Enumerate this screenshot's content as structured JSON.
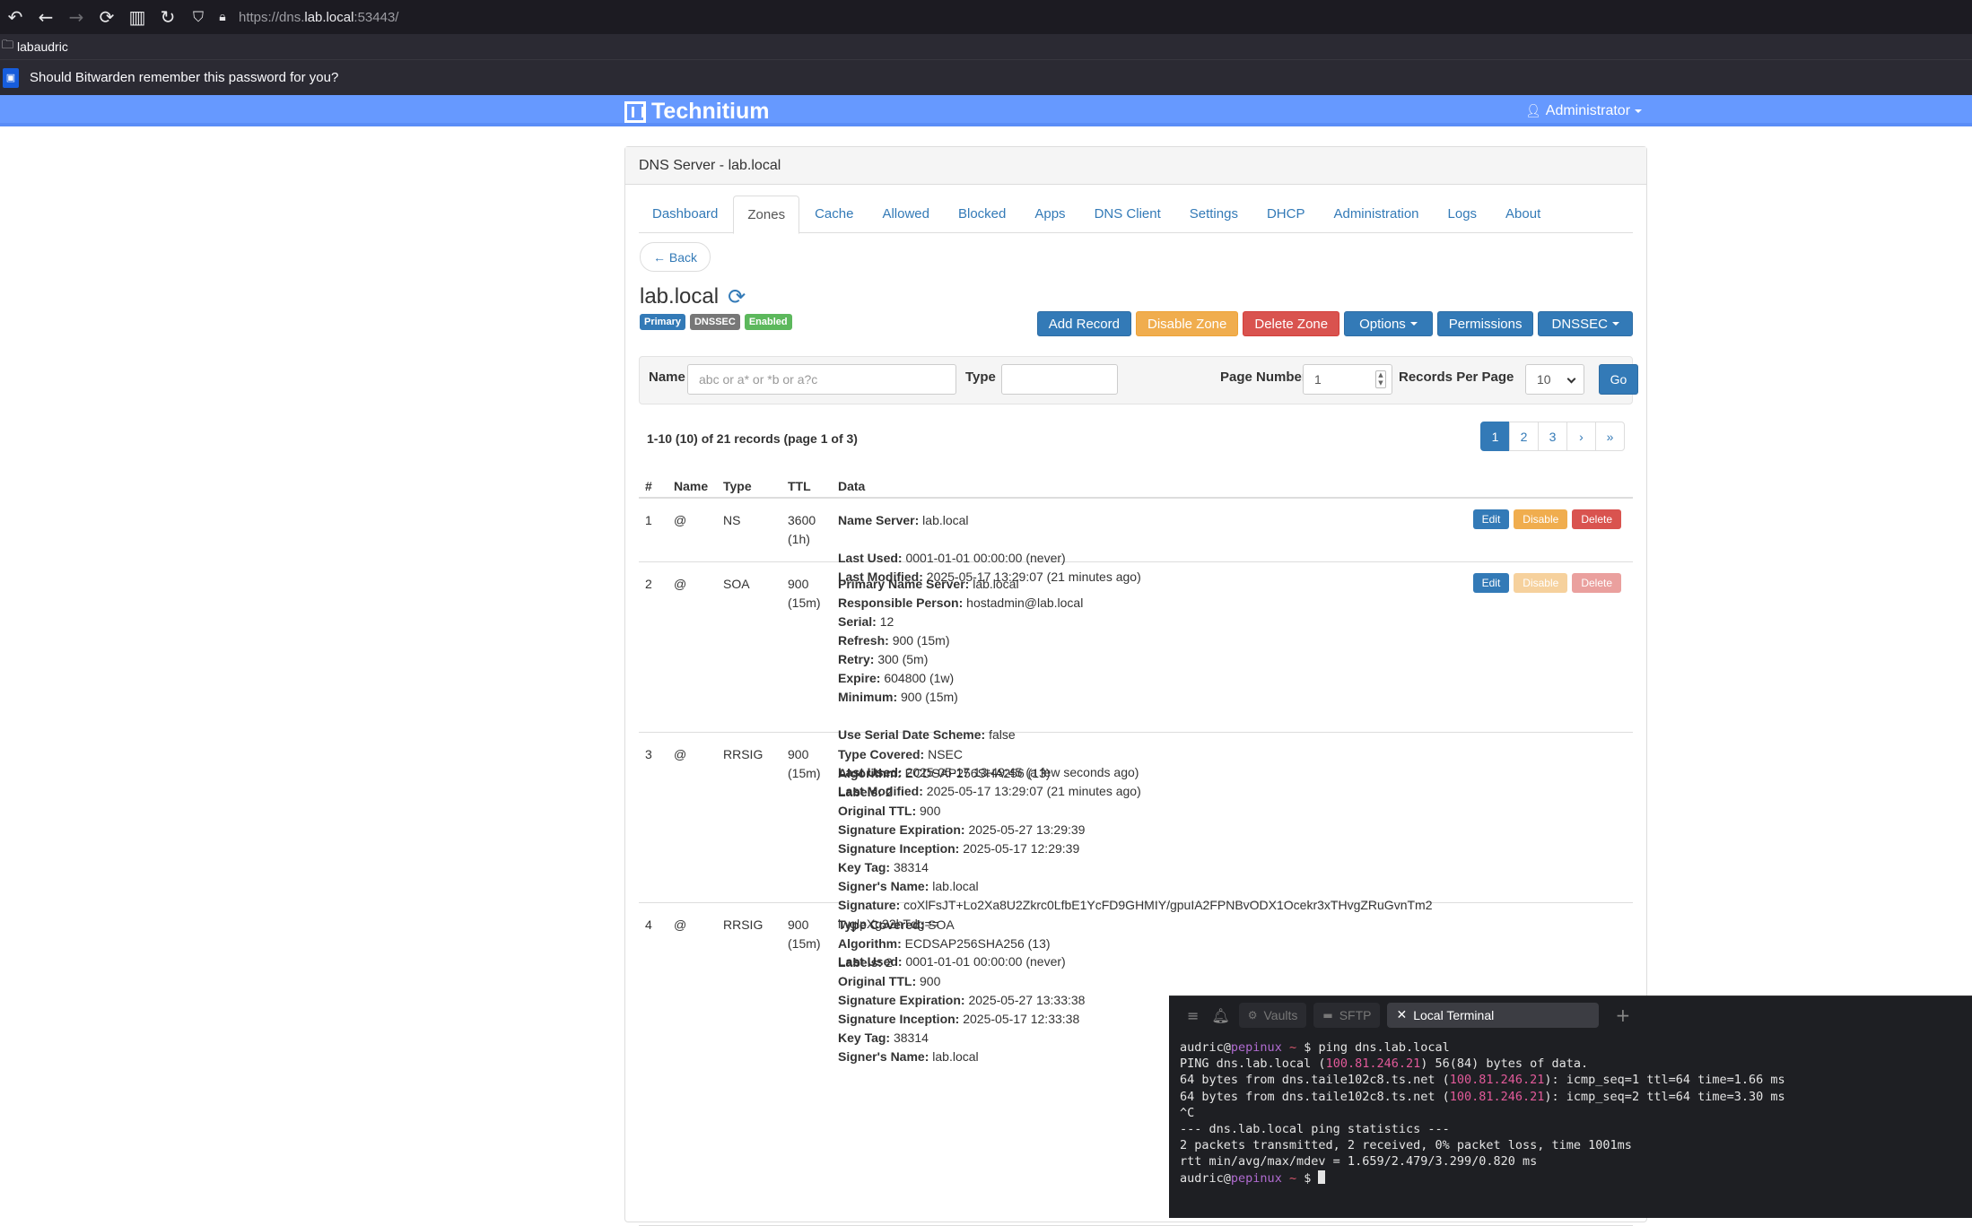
{
  "browser": {
    "url_scheme": "https://dns.",
    "url_host": "lab.local",
    "url_rest": ":53443/",
    "bookmark": "labaudric",
    "bitwarden_prompt": "Should Bitwarden remember this password for you?"
  },
  "app": {
    "brand": "Technitium",
    "user": "Administrator",
    "panel_title": "DNS Server - lab.local",
    "tabs": [
      "Dashboard",
      "Zones",
      "Cache",
      "Allowed",
      "Blocked",
      "Apps",
      "DNS Client",
      "Settings",
      "DHCP",
      "Administration",
      "Logs",
      "About"
    ],
    "active_tab": "Zones",
    "back_label": "← Back"
  },
  "zone": {
    "name": "lab.local",
    "badges": [
      {
        "label": "Primary",
        "color": "#337ab7"
      },
      {
        "label": "DNSSEC",
        "color": "#777777"
      },
      {
        "label": "Enabled",
        "color": "#5cb85c"
      }
    ],
    "actions": {
      "add_record": "Add Record",
      "disable_zone": "Disable Zone",
      "delete_zone": "Delete Zone",
      "options": "Options",
      "permissions": "Permissions",
      "dnssec": "DNSSEC"
    }
  },
  "filter": {
    "name_label": "Name",
    "name_placeholder": "abc or a* or *b or a?c",
    "type_label": "Type",
    "type_value": "",
    "page_number_label": "Page Number",
    "page_number_value": "1",
    "records_per_page_label": "Records Per Page",
    "records_per_page_value": "10",
    "go_label": "Go"
  },
  "records_summary": "1-10 (10) of 21 records (page 1 of 3)",
  "pagination": [
    "1",
    "2",
    "3",
    "›",
    "»"
  ],
  "table": {
    "headers": [
      "#",
      "Name",
      "Type",
      "TTL",
      "Data"
    ],
    "row_buttons": {
      "edit": "Edit",
      "disable": "Disable",
      "delete": "Delete"
    },
    "rows": [
      {
        "num": "1",
        "name": "@",
        "type": "NS",
        "ttl": "3600",
        "ttl_human": "(1h)",
        "data": [
          {
            "k": "Name Server:",
            "v": "lab.local"
          },
          {
            "gap": true
          },
          {
            "k": "Last Used:",
            "v": "0001-01-01 00:00:00 (never)"
          },
          {
            "k": "Last Modified:",
            "v": "2025-05-17 13:29:07 (21 minutes ago)"
          }
        ],
        "actions_enabled": true
      },
      {
        "num": "2",
        "name": "@",
        "type": "SOA",
        "ttl": "900",
        "ttl_human": "(15m)",
        "data": [
          {
            "k": "Primary Name Server:",
            "v": "lab.local"
          },
          {
            "k": "Responsible Person:",
            "v": "hostadmin@lab.local"
          },
          {
            "k": "Serial:",
            "v": "12"
          },
          {
            "k": "Refresh:",
            "v": "900 (15m)"
          },
          {
            "k": "Retry:",
            "v": "300 (5m)"
          },
          {
            "k": "Expire:",
            "v": "604800 (1w)"
          },
          {
            "k": "Minimum:",
            "v": "900 (15m)"
          },
          {
            "gap": true
          },
          {
            "k": "Use Serial Date Scheme:",
            "v": "false"
          },
          {
            "gap": true
          },
          {
            "k": "Last Used:",
            "v": "2025-05-17 13:49:45 (a few seconds ago)"
          },
          {
            "k": "Last Modified:",
            "v": "2025-05-17 13:29:07 (21 minutes ago)"
          }
        ],
        "actions_enabled": false
      },
      {
        "num": "3",
        "name": "@",
        "type": "RRSIG",
        "ttl": "900",
        "ttl_human": "(15m)",
        "data": [
          {
            "k": "Type Covered:",
            "v": "NSEC"
          },
          {
            "k": "Algorithm:",
            "v": "ECDSAP256SHA256 (13)"
          },
          {
            "k": "Labels:",
            "v": "2"
          },
          {
            "k": "Original TTL:",
            "v": "900"
          },
          {
            "k": "Signature Expiration:",
            "v": "2025-05-27 13:29:39"
          },
          {
            "k": "Signature Inception:",
            "v": "2025-05-17 12:29:39"
          },
          {
            "k": "Key Tag:",
            "v": "38314"
          },
          {
            "k": "Signer's Name:",
            "v": "lab.local"
          },
          {
            "k": "Signature:",
            "v": "coXlFsJT+Lo2Xa8U2Zkrc0LfbE1YcFD9GHMIY/gpuIA2FPNBvODX1Ocekr3xTHvgZRuGvnTm2"
          },
          {
            "k": "",
            "v": "lwglpXg32hTdg=="
          },
          {
            "gap": true
          },
          {
            "k": "Last Used:",
            "v": "0001-01-01 00:00:00 (never)"
          }
        ],
        "actions_enabled": null
      },
      {
        "num": "4",
        "name": "@",
        "type": "RRSIG",
        "ttl": "900",
        "ttl_human": "(15m)",
        "data": [
          {
            "k": "Type Covered:",
            "v": "SOA"
          },
          {
            "k": "Algorithm:",
            "v": "ECDSAP256SHA256 (13)"
          },
          {
            "k": "Labels:",
            "v": "2"
          },
          {
            "k": "Original TTL:",
            "v": "900"
          },
          {
            "k": "Signature Expiration:",
            "v": "2025-05-27 13:33:38"
          },
          {
            "k": "Signature Inception:",
            "v": "2025-05-17 12:33:38"
          },
          {
            "k": "Key Tag:",
            "v": "38314"
          },
          {
            "k": "Signer's Name:",
            "v": "lab.local"
          }
        ],
        "actions_enabled": null
      }
    ]
  },
  "terminal": {
    "tabs": [
      "Vaults",
      "SFTP",
      "Local Terminal"
    ],
    "user": "audric",
    "host": "pepinux",
    "lines": [
      {
        "prompt": true,
        "cmd": "ping dns.lab.local"
      },
      {
        "parts": [
          "PING dns.lab.local (",
          {
            "ip": "100.81.246.21"
          },
          ") 56(84) bytes of data."
        ]
      },
      {
        "parts": [
          "64 bytes from dns.taile102c8.ts.net (",
          {
            "ip": "100.81.246.21"
          },
          "): icmp_seq=1 ttl=64 time=1.66 ms"
        ]
      },
      {
        "parts": [
          "64 bytes from dns.taile102c8.ts.net (",
          {
            "ip": "100.81.246.21"
          },
          "): icmp_seq=2 ttl=64 time=3.30 ms"
        ]
      },
      {
        "parts": [
          "^C"
        ]
      },
      {
        "parts": [
          "--- dns.lab.local ping statistics ---"
        ]
      },
      {
        "parts": [
          "2 packets transmitted, 2 received, 0% packet loss, time 1001ms"
        ]
      },
      {
        "parts": [
          "rtt min/avg/max/mdev = 1.659/2.479/3.299/0.820 ms"
        ]
      },
      {
        "prompt": true,
        "cmd": ""
      }
    ]
  }
}
